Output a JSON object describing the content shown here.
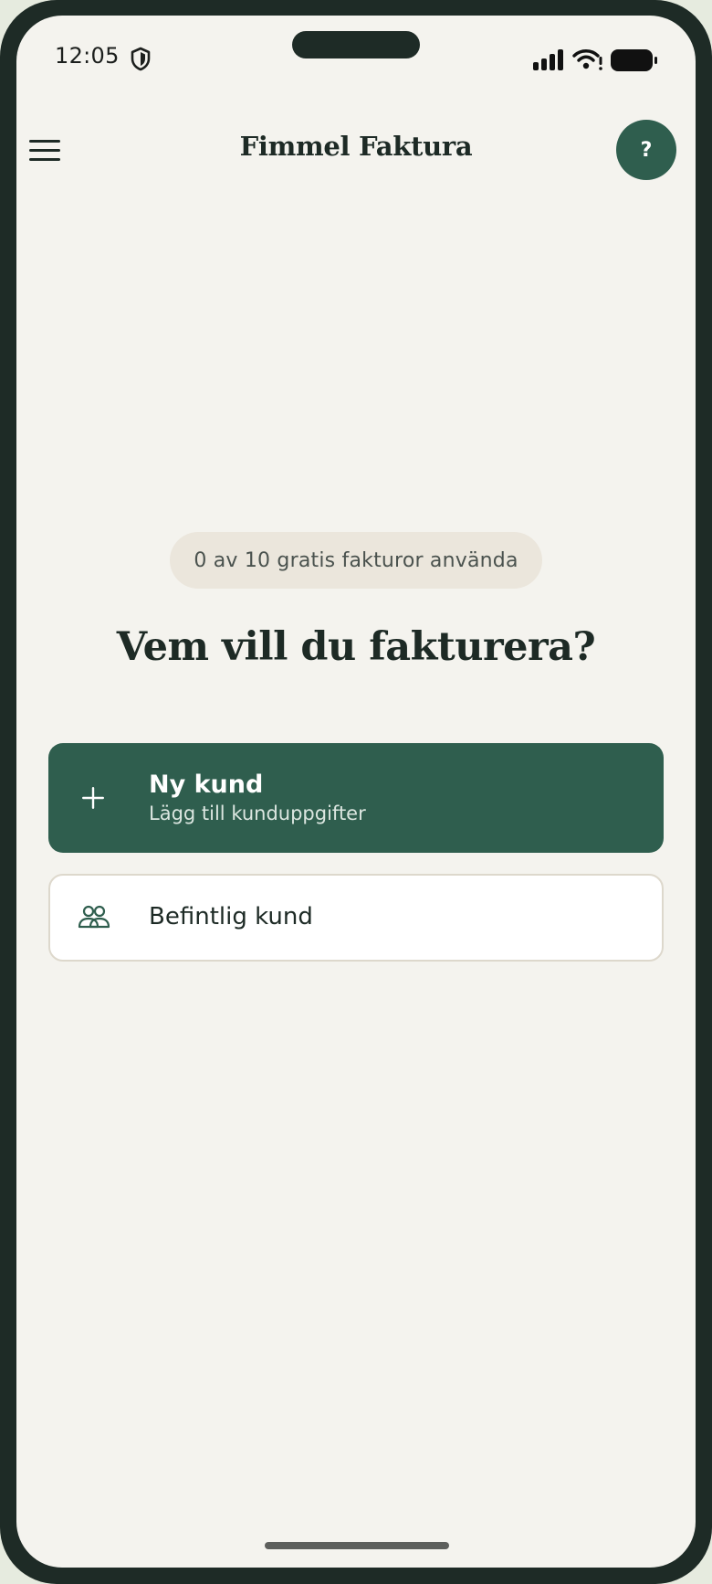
{
  "status_bar": {
    "time": "12:05"
  },
  "header": {
    "title": "Fimmel Faktura",
    "help_label": "?"
  },
  "main": {
    "free_invoices_counter": "0 av 10 gratis fakturor använda",
    "heading": "Vem vill du fakturera?",
    "options": [
      {
        "title": "Ny kund",
        "subtitle": "Lägg till kunduppgifter",
        "icon": "plus-icon"
      },
      {
        "title": "Befintlig kund",
        "icon": "people-icon"
      }
    ]
  },
  "colors": {
    "brand_green": "#2f5e4e",
    "background": "#f4f3ee",
    "device_frame": "#1e2b26",
    "pill_background": "#ebe6dc",
    "text_dark": "#1d2a25"
  }
}
